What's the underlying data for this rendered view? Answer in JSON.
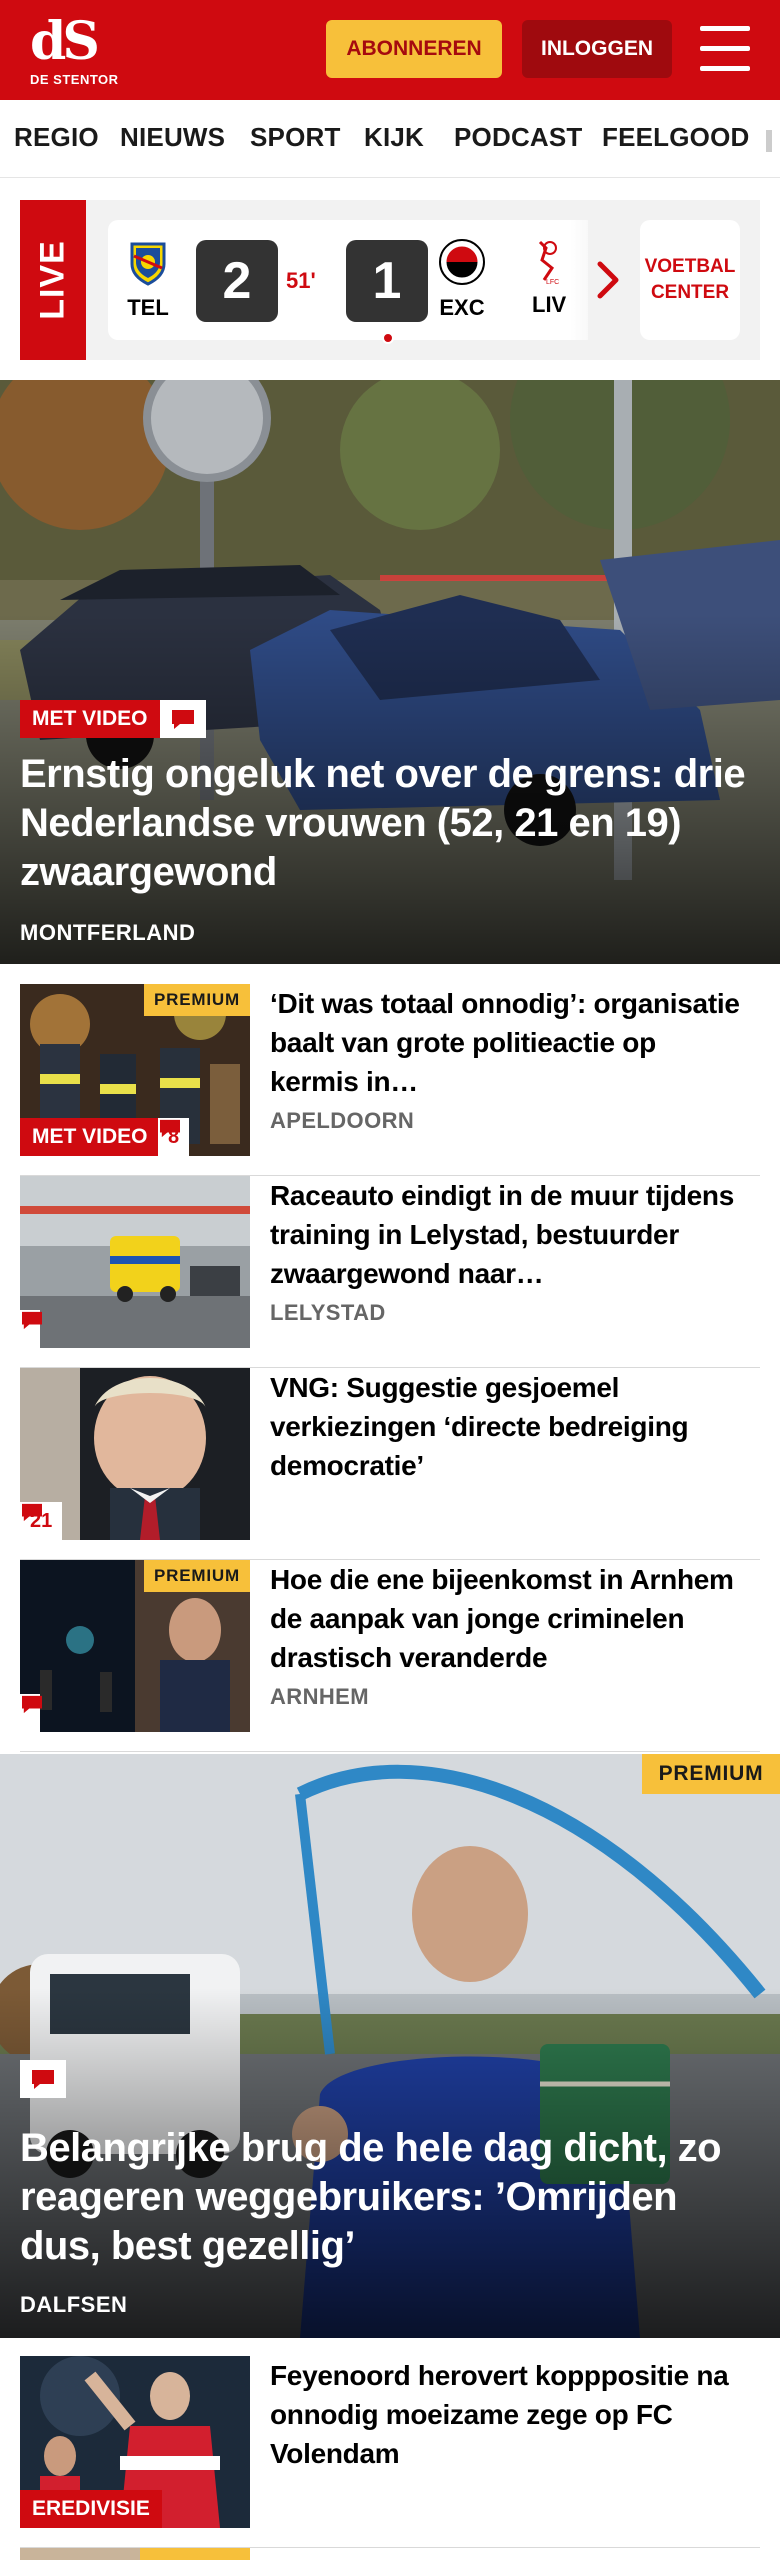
{
  "header": {
    "logo_mark": "dS",
    "logo_text": "DE STENTOR",
    "subscribe_label": "ABONNEREN",
    "login_label": "INLOGGEN",
    "menu_icon": "hamburger-menu-icon",
    "colors": {
      "brand_red": "#cf0a10",
      "subscribe_yellow": "#f7c03a",
      "login_dark_red": "#9f0a0e"
    }
  },
  "nav": {
    "items": [
      "REGIO",
      "NIEUWS",
      "SPORT",
      "KIJK",
      "PODCAST",
      "FEELGOOD"
    ]
  },
  "live": {
    "label": "LIVE",
    "match": {
      "home_abbr": "TEL",
      "home_score": "2",
      "minute": "51'",
      "away_score": "1",
      "away_abbr": "EXC"
    },
    "next_match_abbr": "LIV",
    "football_center_label_1": "VOETBAL",
    "football_center_label_2": "CENTER"
  },
  "hero": {
    "badge": "MET VIDEO",
    "title": "Ernstig ongeluk net over de grens: drie Nederlandse vrouwen (52, 21 en 19) zwaargewond",
    "location": "MONTFERLAND"
  },
  "articles": [
    {
      "title": "‘Dit was totaal onnodig’: organisatie baalt van grote politieactie op kermis in…",
      "location": "APELDOORN",
      "premium": "PREMIUM",
      "video_badge": "MET VIDEO",
      "comments": "8"
    },
    {
      "title": "Raceauto eindigt in de muur tijdens training in Lelystad, bestuurder zwaargewond naar…",
      "location": "LELYSTAD"
    },
    {
      "title": "VNG: Suggestie gesjoemel verkiezingen ‘directe bedreiging democratie’",
      "comments": "21"
    },
    {
      "title": "Hoe die ene bijeenkomst in Arnhem de aanpak van jonge criminelen drastisch veranderde",
      "location": "ARNHEM",
      "premium": "PREMIUM"
    }
  ],
  "hero2": {
    "premium": "PREMIUM",
    "title": "Belangrijke brug de hele dag dicht, zo reageren weggebruikers: ’Omrijden dus, best gezellig’",
    "location": "DALFSEN"
  },
  "article_sport": {
    "title": "Feyenoord herovert kopppositie na onnodig moeizame zege op FC Volendam",
    "category": "EREDIVISIE"
  }
}
